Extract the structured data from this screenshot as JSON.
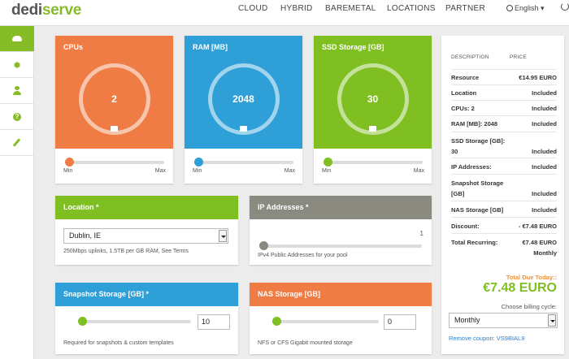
{
  "header": {
    "logo_main": "dedi",
    "logo_accent": "serve",
    "nav": [
      "CLOUD",
      "HYBRID",
      "BAREMETAL",
      "LOCATIONS",
      "PARTNER"
    ],
    "language": "English"
  },
  "sidebar": {
    "items": [
      "cloud-icon",
      "gear-icon",
      "user-icon",
      "help-icon",
      "pencil-icon"
    ],
    "help_glyph": "?"
  },
  "colors": {
    "orange": "#ef7c45",
    "blue": "#2f9fd8",
    "green": "#7fbf22",
    "gray": "#8a8a80"
  },
  "cpus": {
    "title": "CPUs",
    "value": "2",
    "min": "Min",
    "max": "Max",
    "slider_fraction": 0.0
  },
  "ram": {
    "title": "RAM [MB]",
    "value": "2048",
    "min": "Min",
    "max": "Max",
    "slider_fraction": 0.0
  },
  "ssd": {
    "title": "SSD Storage [GB]",
    "value": "30",
    "min": "Min",
    "max": "Max",
    "slider_fraction": 0.0
  },
  "location": {
    "title": "Location *",
    "selected": "Dublin, IE",
    "note": "250Mbps uplinks, 1.5TB per GB RAM, See Terms"
  },
  "ip": {
    "title": "IP Addresses *",
    "value": "1",
    "note": "IPv4 Public Addresses for your pool"
  },
  "snapshot": {
    "title": "Snapshot Storage [GB] *",
    "value": "10",
    "note": "Required for snapshots & custom templates"
  },
  "nas": {
    "title": "NAS Storage [GB]",
    "value": "0",
    "note": "NFS or CFS Gigabit mounted storage"
  },
  "summary": {
    "col_description": "DESCRIPTION",
    "col_price": "PRICE",
    "rows": [
      {
        "label": "Resource",
        "price": "€14.95 EURO"
      },
      {
        "label": "Location",
        "price": "Included"
      },
      {
        "label": "CPUs: 2",
        "price": "Included"
      },
      {
        "label": "RAM [MB]: 2048",
        "price": "Included"
      },
      {
        "label": "SSD Storage [GB]:",
        "label2": "30",
        "price": "Included"
      },
      {
        "label": "IP Addresses:",
        "price": "Included"
      },
      {
        "label": "Snapshot Storage",
        "label2": "[GB]",
        "price": "Included"
      },
      {
        "label": "NAS Storage [GB]",
        "price": "Included"
      },
      {
        "label": "Discount:",
        "price": "- €7.48 EURO"
      },
      {
        "label": "Total Recurring:",
        "price": "€7.48 EURO",
        "price2": "Monthly"
      }
    ],
    "total_label": "Total Due Today::",
    "total_value": "€7.48 EURO",
    "cycle_label": "Choose billing cycle:",
    "cycle_selected": "Monthly",
    "coupon": "Remove coupon: VS9BIAL9"
  }
}
